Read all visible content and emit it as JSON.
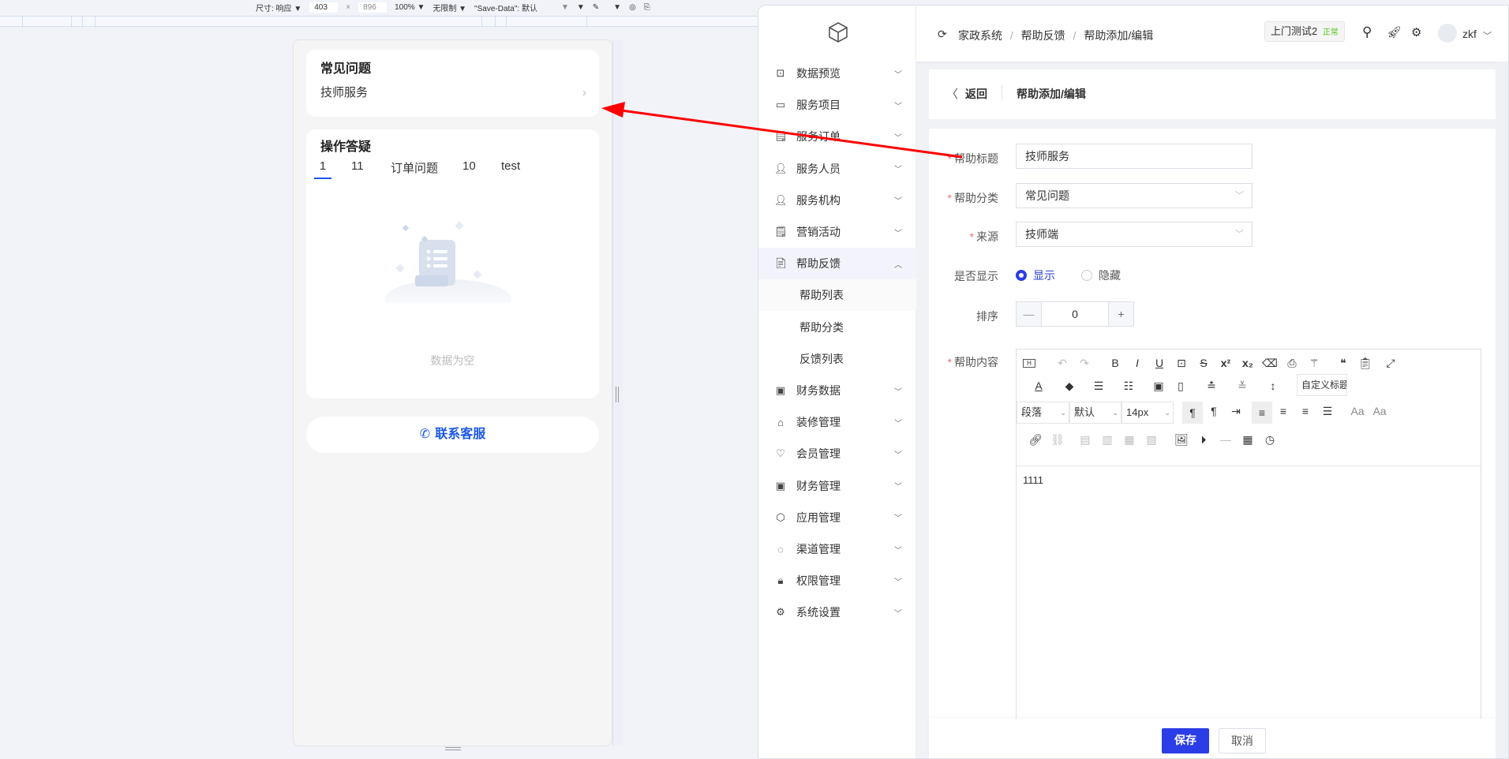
{
  "devtools": {
    "dimensions_label": "尺寸: 响应",
    "width": "403",
    "times": "×",
    "height": "896",
    "zoom": "100%",
    "throttle": "无限制",
    "save_data": "\"Save-Data\": 默认"
  },
  "phone": {
    "faq_title": "常见问题",
    "faq_items": [
      {
        "label": "技师服务"
      }
    ],
    "ops_title": "操作答疑",
    "tabs": [
      "1",
      "11",
      "订单问题",
      "10",
      "test"
    ],
    "active_tab": 0,
    "empty_text": "数据为空",
    "contact_label": "联系客服"
  },
  "sidebar": {
    "items": [
      {
        "label": "数据预览",
        "icon": "chart-icon"
      },
      {
        "label": "服务项目",
        "icon": "card-icon"
      },
      {
        "label": "服务订单",
        "icon": "order-icon"
      },
      {
        "label": "服务人员",
        "icon": "user-icon"
      },
      {
        "label": "服务机构",
        "icon": "user-icon"
      },
      {
        "label": "营销活动",
        "icon": "promo-icon"
      },
      {
        "label": "帮助反馈",
        "icon": "help-icon",
        "expanded": true
      },
      {
        "label": "财务数据",
        "icon": "finance-icon"
      },
      {
        "label": "装修管理",
        "icon": "decor-icon"
      },
      {
        "label": "会员管理",
        "icon": "member-icon"
      },
      {
        "label": "财务管理",
        "icon": "finance-icon"
      },
      {
        "label": "应用管理",
        "icon": "app-icon"
      },
      {
        "label": "渠道管理",
        "icon": "channel-icon"
      },
      {
        "label": "权限管理",
        "icon": "lock-icon"
      },
      {
        "label": "系统设置",
        "icon": "gear-icon"
      }
    ],
    "sub_items": [
      "帮助列表",
      "帮助分类",
      "反馈列表"
    ]
  },
  "header": {
    "breadcrumb": [
      "家政系统",
      "帮助反馈",
      "帮助添加/编辑"
    ],
    "separator": "/",
    "tenant": "上门测试2",
    "tenant_status": "正常",
    "user": "zkf"
  },
  "page": {
    "back_label": "返回",
    "title": "帮助添加/编辑"
  },
  "form": {
    "title_label": "帮助标题",
    "title_value": "技师服务",
    "category_label": "帮助分类",
    "category_value": "常见问题",
    "source_label": "来源",
    "source_value": "技师端",
    "visible_label": "是否显示",
    "visible_options": [
      "显示",
      "隐藏"
    ],
    "visible_selected": "显示",
    "sort_label": "排序",
    "sort_value": "0",
    "content_label": "帮助内容",
    "content_value": "1111",
    "editor": {
      "paragraph": "段落",
      "font": "默认",
      "size": "14px",
      "custom_heading": "自定义标题"
    }
  },
  "footer": {
    "save": "保存",
    "cancel": "取消"
  },
  "colors": {
    "primary": "#2b3de6",
    "tab_active": "#1a56e8",
    "required": "#f56c6c",
    "status": "#52c41a",
    "arrow": "#ff0000"
  }
}
